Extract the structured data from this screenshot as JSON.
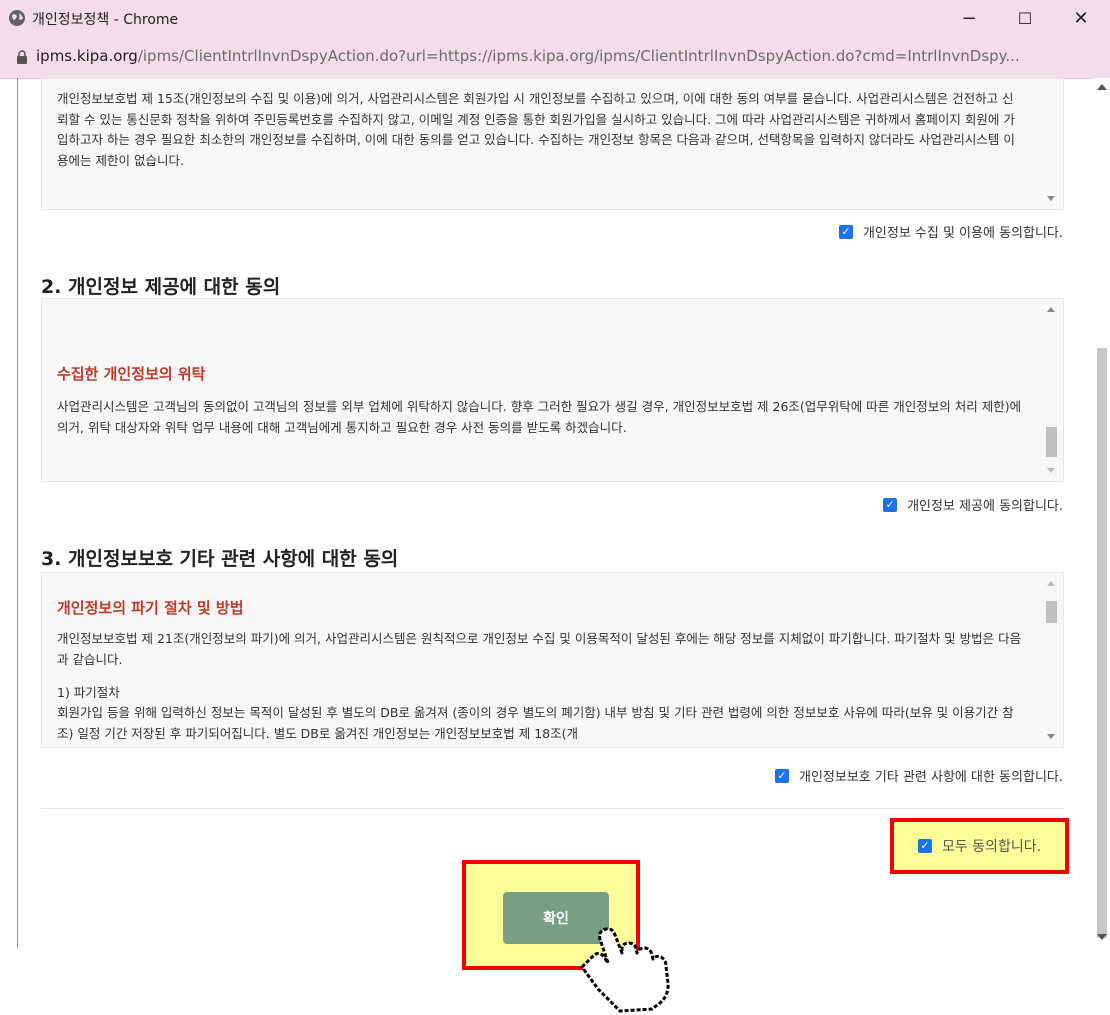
{
  "window": {
    "title": "개인정보정책 - Chrome",
    "url_host": "ipms.kipa.org",
    "url_path": "/ipms/ClientIntrlInvnDspyAction.do?url=https://ipms.kipa.org/ipms/ClientIntrlInvnDspyAction.do?cmd=IntrlInvnDspy...",
    "minimize": "−",
    "maximize": "☐",
    "close": "✕"
  },
  "section1": {
    "text": "개인정보보호법 제 15조(개인정보의 수집 및 이용)에 의거, 사업관리시스템은 회원가입 시 개인정보를 수집하고 있으며, 이에 대한 동의 여부를 묻습니다. 사업관리시스템은 건전하고 신뢰할 수 있는 통신문화 정착을 위하여 주민등록번호를 수집하지 않고, 이메일 계정 인증을 통한 회원가입을 실시하고 있습니다. 그에 따라 사업관리시스템은 귀하께서 홈페이지 회원에 가입하고자 하는 경우 필요한 최소한의 개인정보를 수집하며, 이에 대한 동의를 얻고 있습니다. 수집하는 개인정보 항목은 다음과 같으며, 선택항목을 입력하지 않더라도 사업관리시스템 이용에는 제한이 없습니다.",
    "agree": "개인정보 수집 및 이용에 동의합니다."
  },
  "section2": {
    "title": "2. 개인정보 제공에 대한 동의",
    "subhead": "수집한 개인정보의 위탁",
    "text": "사업관리시스템은 고객님의 동의없이 고객님의 정보를 외부 업체에 위탁하지 않습니다. 향후 그러한 필요가 생길 경우, 개인정보보호법 제 26조(업무위탁에 따른 개인정보의 처리 제한)에 의거, 위탁 대상자와 위탁 업무 내용에 대해 고객님에게 통지하고 필요한 경우 사전 동의를 받도록 하겠습니다.",
    "agree": "개인정보 제공에 동의합니다."
  },
  "section3": {
    "title": "3. 개인정보보호 기타 관련 사항에 대한 동의",
    "subhead": "개인정보의 파기 절차 및 방법",
    "text": "개인정보보호법 제 21조(개인정보의 파기)에 의거, 사업관리시스템은 원칙적으로 개인정보 수집 및 이용목적이 달성된 후에는 해당 정보를 지체없이 파기합니다. 파기절차 및 방법은 다음과 같습니다.",
    "item": "1) 파기절차",
    "item_text": "회원가입 등을 위해 입력하신 정보는 목적이 달성된 후 별도의 DB로 옮겨져 (종이의 경우 별도의 폐기함) 내부 방침 및 기타 관련 법령에 의한 정보보호 사유에 따라(보유 및 이용기간 참조) 일정 기간 저장된 후 파기되어집니다. 별도 DB로 옮겨진 개인정보는 개인정보보호법 제 18조(개",
    "agree": "개인정보보호 기타 관련 사항에 대한 동의합니다."
  },
  "agree_all": "모두 동의합니다.",
  "confirm_button": "확인",
  "colors": {
    "accent": "#1a73e8",
    "subhead": "#c03a2b",
    "highlight": "#ffff99",
    "highlight_border": "#ee0000",
    "button": "#7a9e83"
  }
}
